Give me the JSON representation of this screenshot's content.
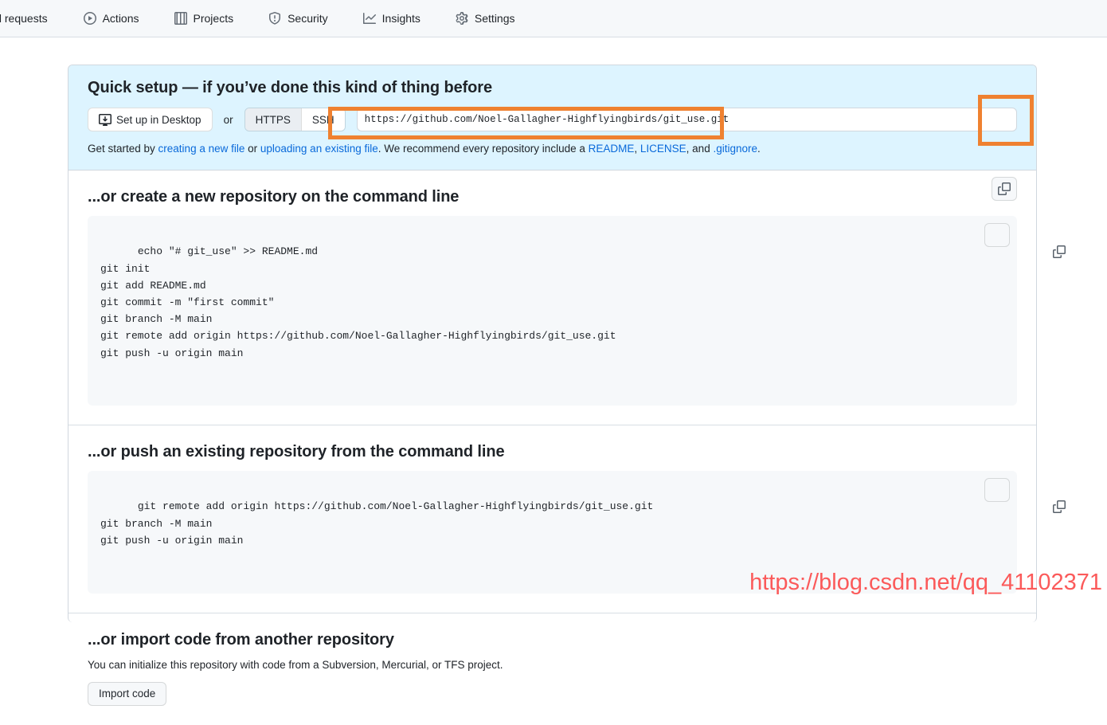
{
  "nav": {
    "items": [
      {
        "label": "ull requests",
        "icon": "pull-request-icon",
        "partial": true
      },
      {
        "label": "Actions",
        "icon": "play-circle-icon"
      },
      {
        "label": "Projects",
        "icon": "projects-table-icon"
      },
      {
        "label": "Security",
        "icon": "shield-icon"
      },
      {
        "label": "Insights",
        "icon": "graph-icon"
      },
      {
        "label": "Settings",
        "icon": "gear-icon"
      }
    ]
  },
  "quick_setup": {
    "title": "Quick setup — if you’ve done this kind of thing before",
    "desktop_button": "Set up in Desktop",
    "desktop_icon": "desktop-download-icon",
    "or_label": "or",
    "protocols": [
      {
        "label": "HTTPS",
        "selected": true
      },
      {
        "label": "SSH",
        "selected": false
      }
    ],
    "clone_url": "https://github.com/Noel-Gallagher-Highflyingbirds/git_use.git",
    "copy_icon": "clipboard-icon",
    "note": {
      "before": "Get started by ",
      "link1": "creating a new file",
      "mid1": " or ",
      "link2": "uploading an existing file",
      "mid2": ". We recommend every repository include a ",
      "link3": "README",
      "sep1": ", ",
      "link4": "LICENSE",
      "mid3": ", and ",
      "link5": ".gitignore",
      "after": "."
    },
    "highlight_color": "#ef8130"
  },
  "create_repo": {
    "title": "...or create a new repository on the command line",
    "code": "echo \"# git_use\" >> README.md\ngit init\ngit add README.md\ngit commit -m \"first commit\"\ngit branch -M main\ngit remote add origin https://github.com/Noel-Gallagher-Highflyingbirds/git_use.git\ngit push -u origin main",
    "copy_icon": "clipboard-icon"
  },
  "push_repo": {
    "title": "...or push an existing repository from the command line",
    "code": "git remote add origin https://github.com/Noel-Gallagher-Highflyingbirds/git_use.git\ngit branch -M main\ngit push -u origin main",
    "copy_icon": "clipboard-icon"
  },
  "import_repo": {
    "title": "...or import code from another repository",
    "description": "You can initialize this repository with code from a Subversion, Mercurial, or TFS project.",
    "button": "Import code"
  },
  "watermark": {
    "text": "https://blog.csdn.net/qq_41102371",
    "color": "#fb5a5a"
  }
}
